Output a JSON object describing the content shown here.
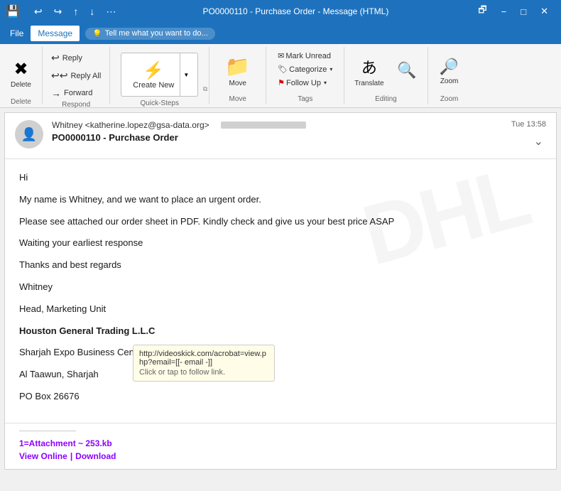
{
  "titlebar": {
    "save_icon": "💾",
    "undo_icon": "↩",
    "redo_icon": "↪",
    "up_icon": "↑",
    "down_icon": "↓",
    "more_icon": "⋯",
    "title": "PO0000110 - Purchase Order  -  Message (HTML)",
    "restore_icon": "🗗",
    "minimize_icon": "−",
    "maximize_icon": "□",
    "close_icon": "✕"
  },
  "menubar": {
    "items": [
      {
        "label": "File",
        "active": false
      },
      {
        "label": "Message",
        "active": true
      }
    ],
    "tell_me": "Tell me what you want to do..."
  },
  "ribbon": {
    "groups": [
      {
        "name": "delete",
        "label": "Delete",
        "buttons": [
          {
            "id": "delete",
            "label": "Delete",
            "icon": "✖"
          }
        ]
      },
      {
        "name": "respond",
        "label": "Respond",
        "buttons": [
          {
            "id": "reply",
            "label": "Reply",
            "icon": "↩"
          },
          {
            "id": "reply-all",
            "label": "Reply All",
            "icon": "↩↩"
          },
          {
            "id": "forward",
            "label": "Forward",
            "icon": "→"
          }
        ]
      },
      {
        "name": "quick-steps",
        "label": "Quick Steps",
        "create_new": "Create New",
        "arrow": "▼"
      },
      {
        "name": "move",
        "label": "Move",
        "folder_label": "Move",
        "folder_icon": "📁"
      },
      {
        "name": "tags",
        "label": "Tags",
        "mark_unread": "Mark Unread",
        "categorize": "Categorize",
        "flag": "⚑",
        "follow_up": "Follow Up",
        "expand_arrow": "▾"
      },
      {
        "name": "editing",
        "label": "Editing",
        "translate_label": "Translate",
        "search_label": ""
      },
      {
        "name": "zoom",
        "label": "Zoom",
        "zoom_label": "Zoom"
      }
    ]
  },
  "email": {
    "avatar_icon": "👤",
    "from": "Whitney <katherine.lopez@gsa-data.org>",
    "from_short": "Whitney <katherine.lopez@gsa-data.org>",
    "redacted": true,
    "subject": "PO0000110 - Purchase Order",
    "time": "Tue 13:58",
    "body_lines": [
      "Hi",
      "My name is Whitney, and we want to place an urgent order.",
      "",
      "Please see attached our order sheet in PDF. Kindly check and give us your best price ASAP",
      "",
      "Waiting your earliest response",
      "",
      "Thanks and best regards",
      "Whitney",
      "",
      "Head, Marketing Unit"
    ],
    "company_bold": "Houston General Trading L.L.C",
    "address_lines": [
      "",
      "Sharjah Expo Business Centre, 1st FLoor",
      "Al Taawun, Sharjah",
      "PO Box 26676"
    ],
    "attachment_label": "1=Attachment ~ 253.kb",
    "view_online": "View Online",
    "pipe": "|",
    "download": "Download",
    "tooltip_url": "http://videoskick.com/acrobat=view.php?email=[[- email -]]",
    "tooltip_hint": "Click or tap to follow link.",
    "watermark": "DHL"
  }
}
